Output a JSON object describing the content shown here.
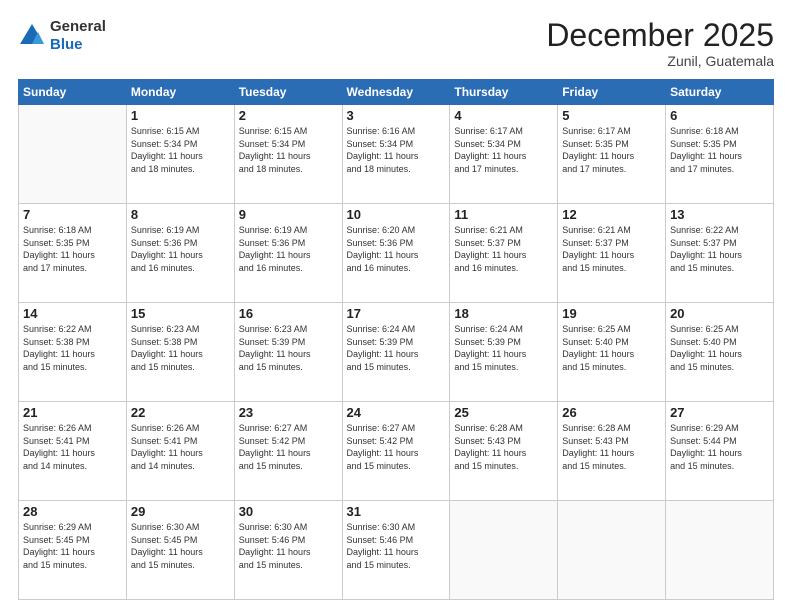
{
  "logo": {
    "general": "General",
    "blue": "Blue"
  },
  "header": {
    "month": "December 2025",
    "location": "Zunil, Guatemala"
  },
  "days_of_week": [
    "Sunday",
    "Monday",
    "Tuesday",
    "Wednesday",
    "Thursday",
    "Friday",
    "Saturday"
  ],
  "weeks": [
    [
      {
        "day": "",
        "info": ""
      },
      {
        "day": "1",
        "info": "Sunrise: 6:15 AM\nSunset: 5:34 PM\nDaylight: 11 hours\nand 18 minutes."
      },
      {
        "day": "2",
        "info": "Sunrise: 6:15 AM\nSunset: 5:34 PM\nDaylight: 11 hours\nand 18 minutes."
      },
      {
        "day": "3",
        "info": "Sunrise: 6:16 AM\nSunset: 5:34 PM\nDaylight: 11 hours\nand 18 minutes."
      },
      {
        "day": "4",
        "info": "Sunrise: 6:17 AM\nSunset: 5:34 PM\nDaylight: 11 hours\nand 17 minutes."
      },
      {
        "day": "5",
        "info": "Sunrise: 6:17 AM\nSunset: 5:35 PM\nDaylight: 11 hours\nand 17 minutes."
      },
      {
        "day": "6",
        "info": "Sunrise: 6:18 AM\nSunset: 5:35 PM\nDaylight: 11 hours\nand 17 minutes."
      }
    ],
    [
      {
        "day": "7",
        "info": "Sunrise: 6:18 AM\nSunset: 5:35 PM\nDaylight: 11 hours\nand 17 minutes."
      },
      {
        "day": "8",
        "info": "Sunrise: 6:19 AM\nSunset: 5:36 PM\nDaylight: 11 hours\nand 16 minutes."
      },
      {
        "day": "9",
        "info": "Sunrise: 6:19 AM\nSunset: 5:36 PM\nDaylight: 11 hours\nand 16 minutes."
      },
      {
        "day": "10",
        "info": "Sunrise: 6:20 AM\nSunset: 5:36 PM\nDaylight: 11 hours\nand 16 minutes."
      },
      {
        "day": "11",
        "info": "Sunrise: 6:21 AM\nSunset: 5:37 PM\nDaylight: 11 hours\nand 16 minutes."
      },
      {
        "day": "12",
        "info": "Sunrise: 6:21 AM\nSunset: 5:37 PM\nDaylight: 11 hours\nand 15 minutes."
      },
      {
        "day": "13",
        "info": "Sunrise: 6:22 AM\nSunset: 5:37 PM\nDaylight: 11 hours\nand 15 minutes."
      }
    ],
    [
      {
        "day": "14",
        "info": "Sunrise: 6:22 AM\nSunset: 5:38 PM\nDaylight: 11 hours\nand 15 minutes."
      },
      {
        "day": "15",
        "info": "Sunrise: 6:23 AM\nSunset: 5:38 PM\nDaylight: 11 hours\nand 15 minutes."
      },
      {
        "day": "16",
        "info": "Sunrise: 6:23 AM\nSunset: 5:39 PM\nDaylight: 11 hours\nand 15 minutes."
      },
      {
        "day": "17",
        "info": "Sunrise: 6:24 AM\nSunset: 5:39 PM\nDaylight: 11 hours\nand 15 minutes."
      },
      {
        "day": "18",
        "info": "Sunrise: 6:24 AM\nSunset: 5:39 PM\nDaylight: 11 hours\nand 15 minutes."
      },
      {
        "day": "19",
        "info": "Sunrise: 6:25 AM\nSunset: 5:40 PM\nDaylight: 11 hours\nand 15 minutes."
      },
      {
        "day": "20",
        "info": "Sunrise: 6:25 AM\nSunset: 5:40 PM\nDaylight: 11 hours\nand 15 minutes."
      }
    ],
    [
      {
        "day": "21",
        "info": "Sunrise: 6:26 AM\nSunset: 5:41 PM\nDaylight: 11 hours\nand 14 minutes."
      },
      {
        "day": "22",
        "info": "Sunrise: 6:26 AM\nSunset: 5:41 PM\nDaylight: 11 hours\nand 14 minutes."
      },
      {
        "day": "23",
        "info": "Sunrise: 6:27 AM\nSunset: 5:42 PM\nDaylight: 11 hours\nand 15 minutes."
      },
      {
        "day": "24",
        "info": "Sunrise: 6:27 AM\nSunset: 5:42 PM\nDaylight: 11 hours\nand 15 minutes."
      },
      {
        "day": "25",
        "info": "Sunrise: 6:28 AM\nSunset: 5:43 PM\nDaylight: 11 hours\nand 15 minutes."
      },
      {
        "day": "26",
        "info": "Sunrise: 6:28 AM\nSunset: 5:43 PM\nDaylight: 11 hours\nand 15 minutes."
      },
      {
        "day": "27",
        "info": "Sunrise: 6:29 AM\nSunset: 5:44 PM\nDaylight: 11 hours\nand 15 minutes."
      }
    ],
    [
      {
        "day": "28",
        "info": "Sunrise: 6:29 AM\nSunset: 5:45 PM\nDaylight: 11 hours\nand 15 minutes."
      },
      {
        "day": "29",
        "info": "Sunrise: 6:30 AM\nSunset: 5:45 PM\nDaylight: 11 hours\nand 15 minutes."
      },
      {
        "day": "30",
        "info": "Sunrise: 6:30 AM\nSunset: 5:46 PM\nDaylight: 11 hours\nand 15 minutes."
      },
      {
        "day": "31",
        "info": "Sunrise: 6:30 AM\nSunset: 5:46 PM\nDaylight: 11 hours\nand 15 minutes."
      },
      {
        "day": "",
        "info": ""
      },
      {
        "day": "",
        "info": ""
      },
      {
        "day": "",
        "info": ""
      }
    ]
  ]
}
